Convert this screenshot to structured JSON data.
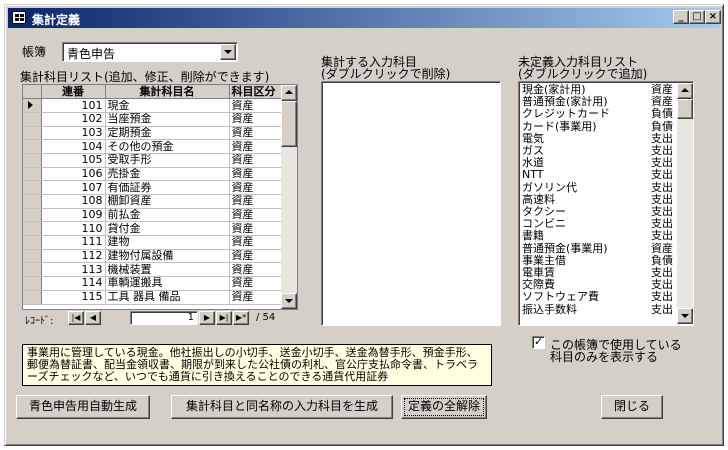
{
  "window": {
    "title": "集計定義"
  },
  "titlebar_buttons": {
    "minimize": "_",
    "maximize": "□",
    "close": "×"
  },
  "ledger": {
    "label": "帳簿",
    "value": "青色申告"
  },
  "summary_list": {
    "label": "集計科目リスト(追加、修正、削除ができます)",
    "columns": [
      "連番",
      "集計科目名",
      "科目区分"
    ],
    "rows": [
      [
        "101",
        "現金",
        "資産"
      ],
      [
        "102",
        "当座預金",
        "資産"
      ],
      [
        "103",
        "定期預金",
        "資産"
      ],
      [
        "104",
        "その他の預金",
        "資産"
      ],
      [
        "105",
        "受取手形",
        "資産"
      ],
      [
        "106",
        "売掛金",
        "資産"
      ],
      [
        "107",
        "有価証券",
        "資産"
      ],
      [
        "108",
        "棚卸資産",
        "資産"
      ],
      [
        "109",
        "前払金",
        "資産"
      ],
      [
        "110",
        "貸付金",
        "資産"
      ],
      [
        "111",
        "建物",
        "資産"
      ],
      [
        "112",
        "建物付属設備",
        "資産"
      ],
      [
        "113",
        "機械装置",
        "資産"
      ],
      [
        "114",
        "車輌運搬具",
        "資産"
      ],
      [
        "115",
        "工具 器具 備品",
        "資産"
      ]
    ]
  },
  "record_nav": {
    "label": "ﾚｺｰﾄﾞ:",
    "current": "1",
    "total": "/ 54",
    "first": "|◀",
    "prev": "◀",
    "next": "▶",
    "last": "▶|",
    "new": "▶*"
  },
  "input_list": {
    "label_line1": "集計する入力科目",
    "label_line2": "(ダブルクリックで削除)"
  },
  "undefined_list": {
    "label_line1": "未定義入力科目リスト",
    "label_line2": "(ダブルクリックで追加)",
    "rows": [
      [
        "現金(家計用)",
        "資産"
      ],
      [
        "普通預金(家計用)",
        "資産"
      ],
      [
        "クレジットカード",
        "負債"
      ],
      [
        "カード(事業用)",
        "負債"
      ],
      [
        "電気",
        "支出"
      ],
      [
        "ガス",
        "支出"
      ],
      [
        "水道",
        "支出"
      ],
      [
        "NTT",
        "支出"
      ],
      [
        "ガソリン代",
        "支出"
      ],
      [
        "高速料",
        "支出"
      ],
      [
        "タクシー",
        "支出"
      ],
      [
        "コンビニ",
        "支出"
      ],
      [
        "書籍",
        "支出"
      ],
      [
        "普通預金(事業用)",
        "資産"
      ],
      [
        "事業主借",
        "負債"
      ],
      [
        "電車賃",
        "支出"
      ],
      [
        "交際費",
        "支出"
      ],
      [
        "ソフトウェア費",
        "支出"
      ],
      [
        "振込手数料",
        "支出"
      ]
    ]
  },
  "description": "事業用に管理している現金。他社振出しの小切手、送金小切手、送金為替手形、預金手形、郵便為替証書、配当金領収書、期限が到来した公社債の利札、官公庁支払命令書、トラベラーズチェックなど、いつでも通貨に引き換えることのできる通貨代用証券",
  "checkbox": {
    "checked": true,
    "label_line1": "この帳簿で使用している",
    "label_line2": "科目のみを表示する"
  },
  "buttons": {
    "generate_blue": "青色申告用自動生成",
    "generate_same": "集計科目と同名称の入力科目を生成",
    "clear_all": "定義の全解除",
    "close": "閉じる"
  }
}
